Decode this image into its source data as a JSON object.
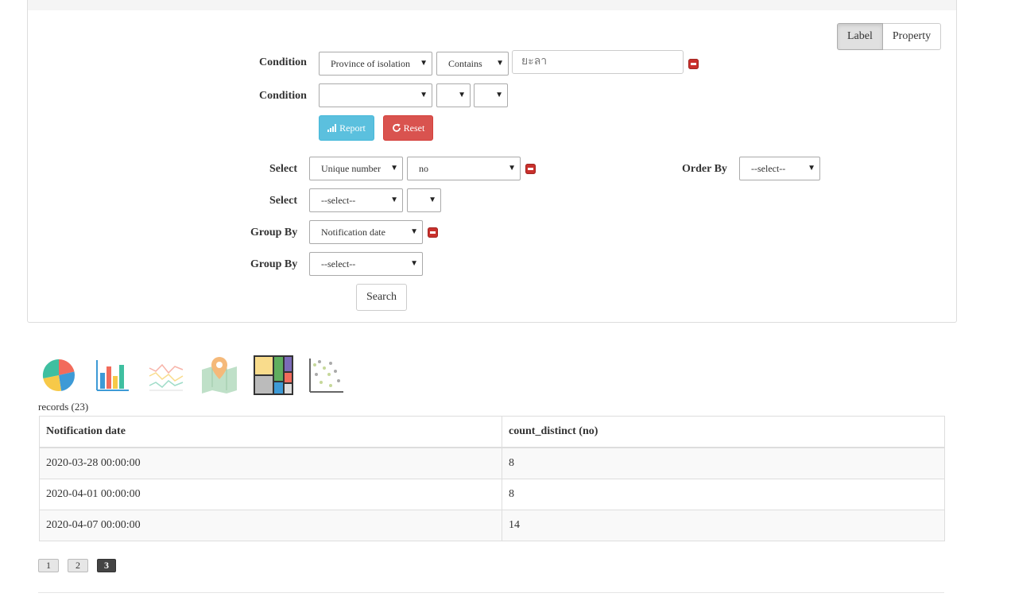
{
  "view_toggle": {
    "label": "Label",
    "property": "Property"
  },
  "conditions": {
    "label": "Condition",
    "row1": {
      "field": "Province of isolation",
      "operator": "Contains",
      "value": "ยะลา"
    },
    "row2": {
      "field": "",
      "operator": "",
      "extra": ""
    }
  },
  "buttons": {
    "report": "Report",
    "reset": "Reset",
    "search": "Search"
  },
  "select": {
    "label": "Select",
    "row1": {
      "field": "Unique number",
      "value": "no"
    },
    "row2": {
      "field": "--select--",
      "value": ""
    }
  },
  "order_by": {
    "label": "Order By",
    "value": "--select--"
  },
  "group_by": {
    "label": "Group By",
    "row1": "Notification date",
    "row2": "--select--"
  },
  "chart_types": [
    "pie-chart-icon",
    "bar-chart-icon",
    "line-chart-icon",
    "map-icon",
    "treemap-icon",
    "scatter-plot-icon"
  ],
  "records_label": "records (23)",
  "table": {
    "headers": [
      "Notification date",
      "count_distinct (no)"
    ],
    "rows": [
      [
        "2020-03-28 00:00:00",
        "8"
      ],
      [
        "2020-04-01 00:00:00",
        "8"
      ],
      [
        "2020-04-07 00:00:00",
        "14"
      ]
    ]
  },
  "pagination": {
    "pages": [
      "1",
      "2",
      "3"
    ],
    "current": "3"
  }
}
